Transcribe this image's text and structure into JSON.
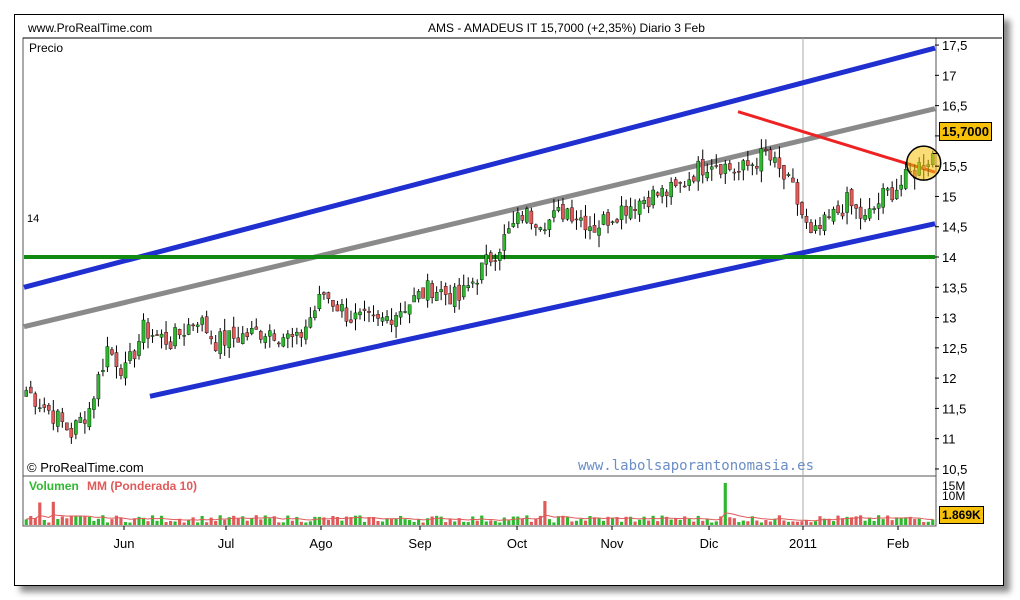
{
  "header": {
    "site": "www.ProRealTime.com",
    "title": "AMS - AMADEUS IT    15,7000 (+2,35%)   Diario  3 Feb"
  },
  "price_panel": {
    "label": "Precio",
    "watermark_left": "© ProRealTime.com",
    "watermark_right": "www.labolsaporantonomasia.es",
    "level_label": "14",
    "last_price_label": "15,7000"
  },
  "volume_panel": {
    "label_volume": "Volumen",
    "label_mm": "MM (Ponderada 10)",
    "axis_labels": [
      "15M",
      "10M"
    ],
    "last_volume_label": "1.869K"
  },
  "colors": {
    "up": "#2fb82f",
    "down": "#e05a5a",
    "channel": "#1f2fd0",
    "midline": "#8a8a8a",
    "support": "#128a12",
    "resistance": "#ee2222",
    "highlight": "#f7c10a",
    "volume_ma": "#e05a5a"
  },
  "chart_data": {
    "type": "candlestick",
    "x_ticks": [
      "Jun",
      "Jul",
      "Ago",
      "Sep",
      "Oct",
      "Nov",
      "Dic",
      "2011",
      "Feb"
    ],
    "y_ticks": [
      "10,5",
      "11",
      "11,5",
      "12",
      "12,5",
      "13",
      "13,5",
      "14",
      "14,5",
      "15",
      "15,5",
      "16",
      "16,5",
      "17",
      "17,5"
    ],
    "ylim": [
      10.4,
      17.6
    ],
    "bars": 202,
    "close_path": [
      [
        0,
        11.8
      ],
      [
        6,
        11.4
      ],
      [
        10,
        11.1
      ],
      [
        14,
        11.5
      ],
      [
        18,
        12.5
      ],
      [
        22,
        12.1
      ],
      [
        26,
        12.8
      ],
      [
        32,
        12.6
      ],
      [
        38,
        13.0
      ],
      [
        42,
        12.6
      ],
      [
        48,
        12.7
      ],
      [
        54,
        12.8
      ],
      [
        60,
        12.6
      ],
      [
        66,
        13.4
      ],
      [
        72,
        13.0
      ],
      [
        78,
        12.9
      ],
      [
        84,
        13.2
      ],
      [
        90,
        13.5
      ],
      [
        96,
        13.3
      ],
      [
        102,
        13.9
      ],
      [
        106,
        14.3
      ],
      [
        110,
        14.7
      ],
      [
        116,
        14.6
      ],
      [
        120,
        14.8
      ],
      [
        126,
        14.5
      ],
      [
        132,
        14.8
      ],
      [
        138,
        15.0
      ],
      [
        144,
        15.1
      ],
      [
        148,
        15.4
      ],
      [
        152,
        15.6
      ],
      [
        158,
        15.4
      ],
      [
        164,
        15.7
      ],
      [
        170,
        15.1
      ],
      [
        174,
        14.3
      ],
      [
        178,
        14.6
      ],
      [
        182,
        14.9
      ],
      [
        186,
        14.6
      ],
      [
        190,
        15.0
      ],
      [
        194,
        15.2
      ],
      [
        198,
        15.5
      ],
      [
        201,
        15.7
      ]
    ],
    "trend_lines": [
      {
        "name": "channel-upper",
        "points": [
          [
            0,
            13.5
          ],
          [
            202,
            17.45
          ]
        ]
      },
      {
        "name": "channel-midline",
        "points": [
          [
            0,
            12.85
          ],
          [
            202,
            16.45
          ]
        ]
      },
      {
        "name": "channel-lower",
        "points": [
          [
            27,
            11.7
          ],
          [
            202,
            14.55
          ]
        ]
      },
      {
        "name": "support-14",
        "points": [
          [
            0,
            14.0
          ],
          [
            202,
            14.0
          ]
        ]
      },
      {
        "name": "resistance",
        "points": [
          [
            157,
            16.4
          ],
          [
            202,
            15.4
          ]
        ]
      }
    ],
    "volume": {
      "ylim": [
        0,
        16000000
      ],
      "last": 1869000
    }
  }
}
